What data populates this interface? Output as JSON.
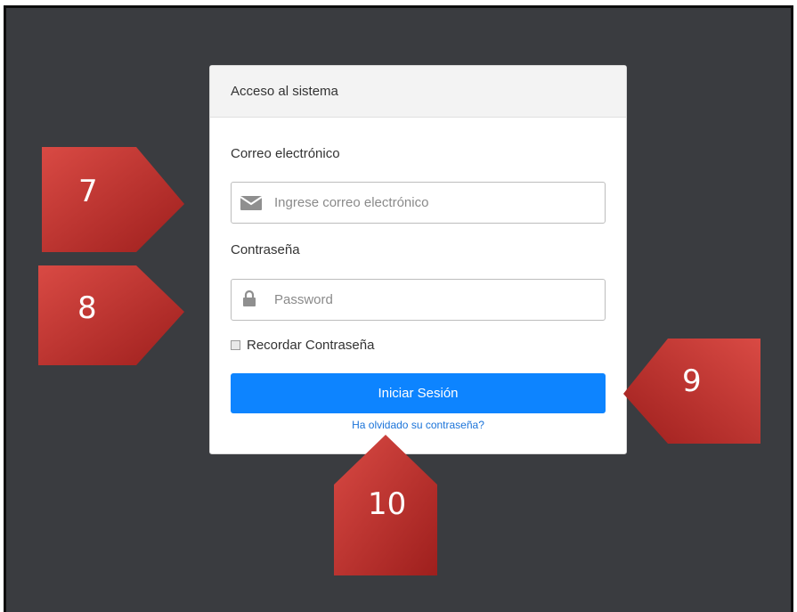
{
  "card": {
    "title": "Acceso al sistema"
  },
  "email": {
    "label": "Correo electrónico",
    "placeholder": "Ingrese correo electrónico",
    "icon": "envelope-icon"
  },
  "password": {
    "label": "Contraseña",
    "placeholder": "Password",
    "icon": "lock-icon"
  },
  "remember": {
    "label": "Recordar Contraseña",
    "checked": false
  },
  "login_button": {
    "label": "Iniciar Sesión"
  },
  "forgot_link": {
    "label": "Ha olvidado su contraseña?"
  },
  "callouts": [
    "7",
    "8",
    "9",
    "10"
  ],
  "colors": {
    "background": "#3a3c40",
    "primary": "#0d84ff",
    "callout": "#c0302f",
    "link": "#1a73d9"
  }
}
